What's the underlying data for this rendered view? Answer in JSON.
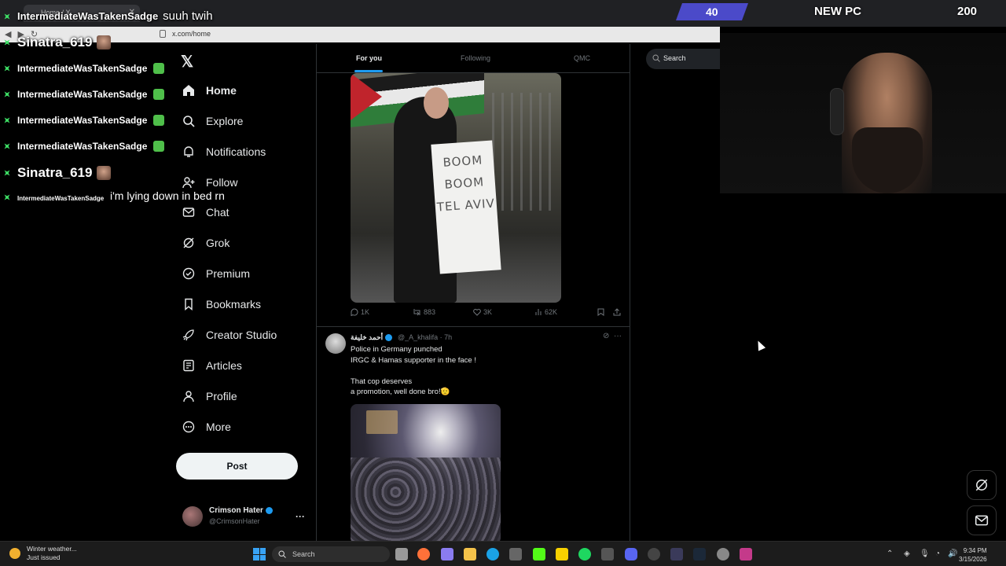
{
  "browser": {
    "tab_title": "Home / X",
    "url": "x.com/home"
  },
  "nav": {
    "items": [
      {
        "label": "Home",
        "icon": "home-icon"
      },
      {
        "label": "Explore",
        "icon": "search-icon"
      },
      {
        "label": "Notifications",
        "icon": "bell-icon"
      },
      {
        "label": "Follow",
        "icon": "person-add-icon"
      },
      {
        "label": "Chat",
        "icon": "mail-icon"
      },
      {
        "label": "Grok",
        "icon": "grok-icon"
      },
      {
        "label": "Premium",
        "icon": "verified-icon"
      },
      {
        "label": "Bookmarks",
        "icon": "bookmark-icon"
      },
      {
        "label": "Creator Studio",
        "icon": "rocket-icon"
      },
      {
        "label": "Articles",
        "icon": "article-icon"
      },
      {
        "label": "Profile",
        "icon": "profile-icon"
      },
      {
        "label": "More",
        "icon": "more-circle-icon"
      }
    ],
    "post_label": "Post",
    "account": {
      "name": "Crimson Hater",
      "handle": "@CrimsonHater",
      "more": "···"
    }
  },
  "feed": {
    "tabs": [
      "For you",
      "Following",
      "QMC"
    ],
    "tweet1": {
      "sign_text": "BOOM BOOM TEL AVIV",
      "replies": "1K",
      "reposts": "883",
      "likes": "3K",
      "views": "62K"
    },
    "tweet2": {
      "name": "أحمد خليفة",
      "handle": "@_A_khalifa · 7h",
      "line1": "Police in Germany punched",
      "line2": "IRGC & Hamas supporter in the face !",
      "line3": "That cop deserves",
      "line4": "a promotion, well done bro!🫡"
    }
  },
  "right": {
    "search_placeholder": "Search"
  },
  "overlay": {
    "top_counter_left": "40",
    "new_pc_label": "NEW PC",
    "top_counter_right": "200",
    "chat": [
      {
        "user": "IntermediateWasTakenSadge",
        "msg": "suuh twih"
      },
      {
        "user": "Sinatra_619",
        "msg": ""
      },
      {
        "user": "IntermediateWasTakenSadge",
        "msg": ""
      },
      {
        "user": "IntermediateWasTakenSadge",
        "msg": ""
      },
      {
        "user": "IntermediateWasTakenSadge",
        "msg": ""
      },
      {
        "user": "IntermediateWasTakenSadge",
        "msg": ""
      },
      {
        "user": "Sinatra_619",
        "msg": ""
      },
      {
        "user": "IntermediateWasTakenSadge",
        "msg": "i'm lying down in bed rn"
      }
    ]
  },
  "taskbar": {
    "weather_title": "Winter weather...",
    "weather_sub": "Just issued",
    "search": "Search",
    "time": "9:34 PM",
    "date": "3/15/2026"
  },
  "colors": {
    "accent": "#1d9bf0",
    "background": "#000000",
    "overlay_bar": "#4b4ac9",
    "chat_badge": "#3ee066"
  }
}
